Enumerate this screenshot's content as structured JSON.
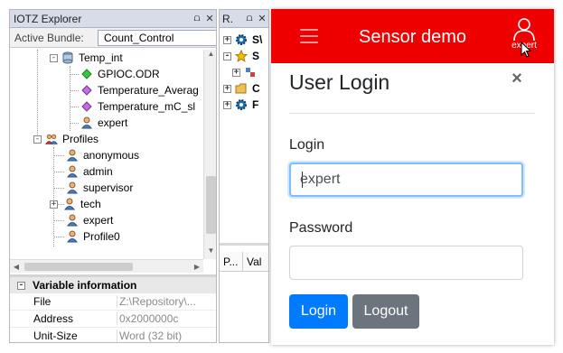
{
  "explorer": {
    "title": "IOTZ Explorer",
    "pin_glyph": "⩍",
    "close_glyph": "✕",
    "bundle_label": "Active Bundle:",
    "bundle_value": "Count_Control",
    "tree": [
      {
        "label": "Temp_int",
        "icon": "database-icon",
        "expander": "-"
      },
      {
        "label": "GPIOC.ODR",
        "icon": "green-diamond-icon"
      },
      {
        "label": "Temperature_Averag",
        "icon": "purple-diamond-icon"
      },
      {
        "label": "Temperature_mC_sl",
        "icon": "purple-diamond-icon"
      },
      {
        "label": "expert",
        "icon": "user-icon"
      },
      {
        "label": "Profiles",
        "icon": "profiles-group-icon",
        "expander": "-"
      },
      {
        "label": "anonymous",
        "icon": "user-icon"
      },
      {
        "label": "admin",
        "icon": "user-icon"
      },
      {
        "label": "supervisor",
        "icon": "user-icon"
      },
      {
        "label": "tech",
        "icon": "user-icon",
        "expander": "+"
      },
      {
        "label": "expert",
        "icon": "user-icon"
      },
      {
        "label": "Profile0",
        "icon": "user-icon"
      }
    ]
  },
  "variable_info": {
    "title": "Variable information",
    "expander": "-",
    "rows": [
      {
        "key": "File",
        "value": "Z:\\Repository\\..."
      },
      {
        "key": "Address",
        "value": "0x2000000c"
      },
      {
        "key": "Unit-Size",
        "value": "Word (32 bit)"
      }
    ]
  },
  "midpane": {
    "title": "R.",
    "pin_glyph": "⩍",
    "close_glyph": "✕",
    "rows": [
      {
        "label": "S\\",
        "icon": "gear-icon",
        "expander": "+"
      },
      {
        "label": "S",
        "icon": "star-icon",
        "expander": "-"
      },
      {
        "label": "",
        "icon": "node-icon",
        "expander": "+"
      },
      {
        "label": "C",
        "icon": "folder-icon",
        "expander": "+"
      },
      {
        "label": "F",
        "icon": "gear-icon",
        "expander": "+"
      }
    ],
    "columns": [
      "P...",
      "Val"
    ]
  },
  "app": {
    "title": "Sensor demo",
    "username": "expert",
    "colors": {
      "navbar": "#ee0000",
      "primary": "#007bff",
      "secondary": "#6c757d"
    },
    "modal": {
      "title": "User Login",
      "close_glyph": "×",
      "login_label": "Login",
      "login_value": "expert",
      "password_label": "Password",
      "password_value": "",
      "login_button": "Login",
      "logout_button": "Logout"
    }
  }
}
